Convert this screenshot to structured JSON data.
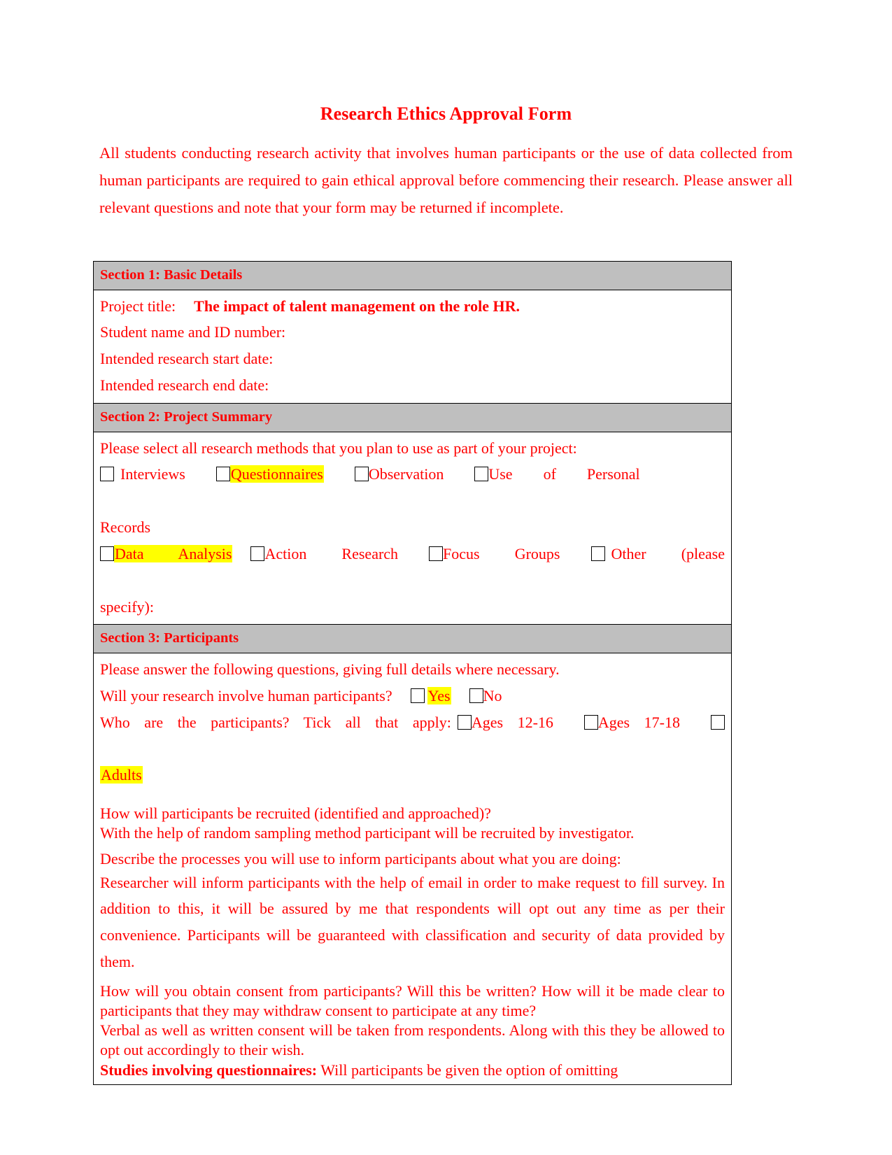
{
  "document": {
    "title": "Research Ethics Approval Form",
    "intro": "All students conducting research activity that involves human participants or the use of data collected from human participants are required to gain ethical approval before commencing their research. Please answer all relevant questions and note that your form may be returned if incomplete.",
    "colors": {
      "text": "#FF0000",
      "section_header_bg": "#BFBFBF",
      "highlight": "#FFFF00",
      "border": "#000000"
    }
  },
  "section1": {
    "header": "Section 1: Basic Details",
    "project_title_label": "Project title:",
    "project_title_value": "The impact of talent management on the role HR.",
    "student_label": "Student name and ID number:",
    "student_value": "",
    "start_date_label": "Intended research start date:",
    "start_date_value": "",
    "end_date_label": "Intended research end date:",
    "end_date_value": ""
  },
  "section2": {
    "header": "Section 2: Project Summary",
    "prompt": "Please select all research methods that you plan to use as part of your project:",
    "methods_row1": [
      {
        "label": "Interviews",
        "checked": false,
        "highlighted": false
      },
      {
        "label": "Questionnaires",
        "checked": false,
        "highlighted": true
      },
      {
        "label": "Observation",
        "checked": false,
        "highlighted": false
      },
      {
        "label": "Use of Personal Records",
        "checked": false,
        "highlighted": false
      }
    ],
    "methods_row2": [
      {
        "label": "Data Analysis",
        "checked": false,
        "highlighted": true
      },
      {
        "label": "Action Research",
        "checked": false,
        "highlighted": false
      },
      {
        "label": "Focus Groups",
        "checked": false,
        "highlighted": false
      },
      {
        "label": "Other (please specify):",
        "checked": false,
        "highlighted": false
      }
    ],
    "m_interviews": "Interviews",
    "m_questionnaires": "Questionnaires",
    "m_observation": "Observation",
    "m_use": "Use",
    "m_of": "of",
    "m_personal": "Personal",
    "m_records": "Records",
    "m_data_analysis": "Data Analysis",
    "m_action_research": "Action Research",
    "m_focus_groups": "Focus  Groups",
    "m_other": "Other  (please",
    "m_specify": "specify):"
  },
  "section3": {
    "header": "Section 3: Participants",
    "prompt": "Please answer the following questions, giving full details where necessary.",
    "human_q": "Will your research involve human participants?",
    "human_yes": "Yes",
    "human_no": "No",
    "human_yes_highlighted": true,
    "who_q": "Who are the participants? Tick all that apply:",
    "who_ages_12_16": "Ages 12-16",
    "who_ages_17_18": "Ages 17-18",
    "who_adults": "Adults",
    "who_adults_highlighted": true,
    "recruit_q": "How will participants be recruited (identified and approached)?",
    "recruit_a": "With the help of random sampling method participant will be recruited by investigator.",
    "inform_q": "Describe the processes you will use to inform participants about what you are doing:",
    "inform_a": "Researcher will inform participants with the help of email in order to make request to fill survey. In addition to this, it will be assured by me that respondents will opt out any time as per their convenience. Participants will be guaranteed with classification and security of data provided by them.",
    "consent_q": "How will you obtain consent from participants? Will this be written? How will it be made clear to participants that they may withdraw consent to participate at any time?",
    "consent_a": "Verbal as well as written consent will be taken from respondents. Along with this they be allowed to opt out accordingly to their wish.",
    "questionnaires_label": "Studies involving questionnaires:",
    "questionnaires_q": " Will participants be given the option of omitting"
  }
}
